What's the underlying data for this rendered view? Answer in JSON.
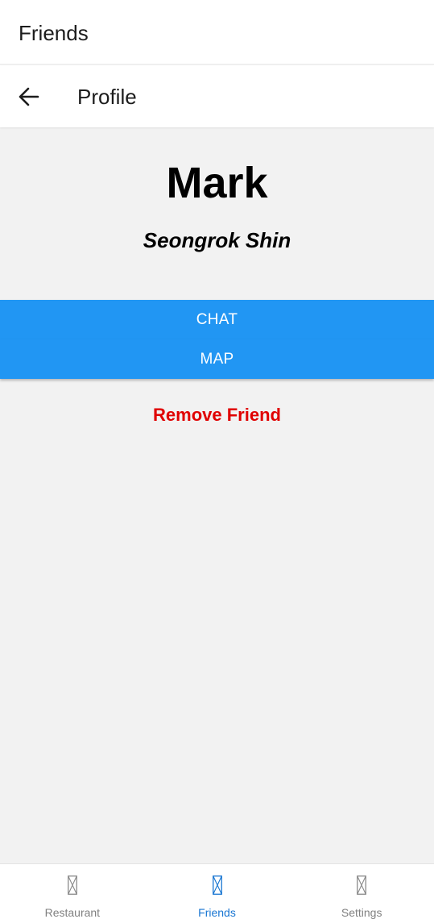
{
  "header": {
    "title": "Friends"
  },
  "profile_bar": {
    "title": "Profile",
    "back_icon": "arrow-left-icon"
  },
  "profile": {
    "nickname": "Mark",
    "full_name": "Seongrok Shin"
  },
  "actions": {
    "chat_label": "CHAT",
    "map_label": "MAP",
    "remove_label": "Remove Friend"
  },
  "bottom_nav": {
    "items": [
      {
        "label": "Restaurant",
        "icon": "placeholder-icon",
        "active": false
      },
      {
        "label": "Friends",
        "icon": "placeholder-icon",
        "active": true
      },
      {
        "label": "Settings",
        "icon": "placeholder-icon",
        "active": false
      }
    ]
  },
  "colors": {
    "accent": "#2196f3",
    "danger": "#e00000",
    "active_tab": "#1976d2",
    "inactive_tab": "#808080",
    "background": "#f2f2f2"
  }
}
